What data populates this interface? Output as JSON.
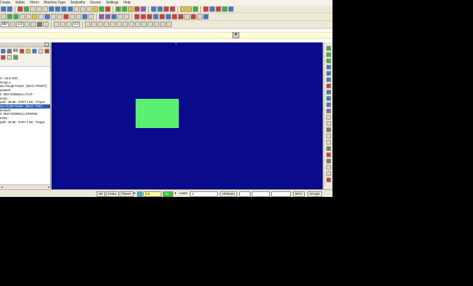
{
  "menu": [
    "Create",
    "Solids",
    "Xform",
    "Machine Type",
    "Toolpaths",
    "Screen",
    "Settings",
    "Help"
  ],
  "toolbar": {
    "field_a": "887",
    "field_b": "0.0",
    "field_c": "0.0"
  },
  "manager": {
    "tab_g1": "G1",
    "tree": [
      "3 - AXIS VMC",
      "Group-1",
      "ace Rough Pocket - [WCS: FRONT]",
      "ameters",
      "0. 3937 ENDMILL1 FLAT -",
      "metry -",
      "path - 65.9K - PART 1.NC - Progra",
      "ace Finish Pocket - [WCS: TOP] -",
      "ameters",
      "0. 3937 ENDMILL2 SPHERE -",
      "metry -",
      "path - 51.9K - PART 1.NC - Progra"
    ],
    "selected_index": 7
  },
  "status": {
    "view3d": "3D",
    "gview": "Gview",
    "planes": "Planes",
    "z_label": "Z",
    "z_value": "0.0",
    "color_value": "10",
    "level_label": "Level",
    "level_value": "1",
    "attributes": "Attributes",
    "wcs": "WCS",
    "groups": "Groups"
  },
  "colors": {
    "viewport_bg": "#0a0a8c",
    "shape": "#5af06f",
    "selection": "#2e5fb3"
  }
}
